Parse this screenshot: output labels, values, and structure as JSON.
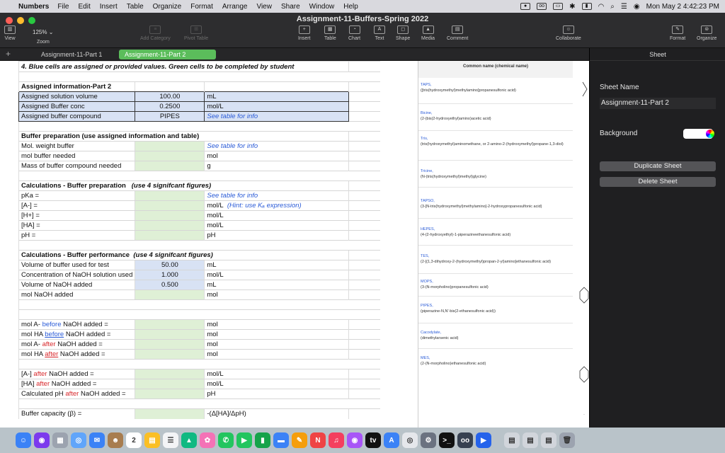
{
  "menubar": {
    "app": "Numbers",
    "items": [
      "File",
      "Edit",
      "Insert",
      "Table",
      "Organize",
      "Format",
      "Arrange",
      "View",
      "Share",
      "Window",
      "Help"
    ],
    "clock": "Mon May 2  4:42:23 PM"
  },
  "window": {
    "title": "Assignment-11-Buffers-Spring 2022",
    "zoom": "125%",
    "toolbar": {
      "view": "View",
      "zoom": "Zoom",
      "add_category": "Add Category",
      "pivot_table": "Pivot Table",
      "insert": "Insert",
      "table": "Table",
      "chart": "Chart",
      "text": "Text",
      "shape": "Shape",
      "media": "Media",
      "comment": "Comment",
      "collaborate": "Collaborate",
      "format": "Format",
      "organize": "Organize"
    }
  },
  "tabs": [
    "Assignment-11-Part 1",
    "Assignment-11-Part 2"
  ],
  "sheet": {
    "instruction": "4. Blue cells are assigned or provided values. Green cells to be completed by student",
    "assigned_header": "Assigned information-Part 2",
    "assigned": [
      {
        "label": "Assigned solution volume",
        "value": "100.00",
        "unit": "mL"
      },
      {
        "label": "Assigned Buffer conc",
        "value": "0.2500",
        "unit": "mol/L"
      },
      {
        "label": "Assigned buffer compound",
        "value": "PIPES",
        "unit": "See table for info"
      }
    ],
    "prep_header": "Buffer preparation (use assigned information and table)",
    "prep": [
      {
        "label": "Mol. weight buffer",
        "unit": "See table for info"
      },
      {
        "label": "mol buffer needed",
        "unit": "mol"
      },
      {
        "label": "Mass of buffer compound needed",
        "unit": "g"
      }
    ],
    "calc_prep_header": "Calculations - Buffer preparation",
    "calc_prep_note": "(use 4 signifcant figures)",
    "calc_prep": [
      {
        "label": "pKa =",
        "unit": "See table for info"
      },
      {
        "label": "[A-] =",
        "unit": "mol/L",
        "hint": "(Hint:  use Kₐ expression)"
      },
      {
        "label": "[H+] =",
        "unit": "mol/L"
      },
      {
        "label": "[HA] =",
        "unit": "mol/L"
      },
      {
        "label": "pH =",
        "unit": "pH"
      }
    ],
    "calc_perf_header": "Calculations - Buffer performance",
    "calc_perf_note": "(use 4 signifcant figures)",
    "calc_perf": [
      {
        "label": "Volume of buffer used for test",
        "value": "50.00",
        "unit": "mL"
      },
      {
        "label": "Concentration of NaOH solution used",
        "value": "1.000",
        "unit": "mol/L"
      },
      {
        "label": "Volume of NaOH added",
        "value": "0.500",
        "unit": "mL"
      },
      {
        "label": "mol NaOH added",
        "value": "",
        "unit": "mol"
      }
    ],
    "mol_rows": [
      {
        "pre": "mol A- ",
        "key": "before",
        "post": " NaOH added =",
        "unit": "mol"
      },
      {
        "pre": "mol HA ",
        "key": "before",
        "post": " NaOH added =",
        "unit": "mol"
      },
      {
        "pre": "mol A- ",
        "key": "after",
        "post": " NaOH added =",
        "unit": "mol"
      },
      {
        "pre": "mol HA ",
        "key": "after",
        "post": " NaOH added =",
        "unit": "mol"
      }
    ],
    "conc_rows": [
      {
        "pre": "[A-] ",
        "key": "after",
        "post": " NaOH added =",
        "unit": "mol/L"
      },
      {
        "pre": "[HA] ",
        "key": "after",
        "post": " NaOH added  =",
        "unit": "mol/L"
      },
      {
        "pre": "Calculated pH ",
        "key": "after",
        "post": " NaOH added =",
        "unit": "pH"
      }
    ],
    "capacity": {
      "label": "Buffer capacity (β)  =",
      "unit": "-(Δ[HA]/ΔpH)"
    }
  },
  "buffer_table": {
    "header": "Common name (chemical name)",
    "rows": [
      {
        "name": "TAPS,",
        "chem": "([tris(hydroxymethyl)methylamino]propanesulfonic acid)"
      },
      {
        "name": "Bicine,",
        "chem": "(2-(bis(2-hydroxyethyl)amino)acetic acid)"
      },
      {
        "name": "Tris,",
        "chem": "(tris(hydroxymethyl)aminomethane, or 2-amino-2-(hydroxymethyl)propane-1,3-diol)"
      },
      {
        "name": "Tricine,",
        "chem": "(N-(tris(hydroxymethyl)methyl)glycine)"
      },
      {
        "name": "TAPSO,",
        "chem": "(3-[N-tris(hydroxymethyl)methylamino]-2-hydroxypropanesulfonic acid)"
      },
      {
        "name": "HEPES,",
        "chem": "(4-(2-hydroxyethyl)-1-piperazineethanesulfonic acid)"
      },
      {
        "name": "TES,",
        "chem": "(2-[(1,3-dihydroxy-2-(hydroxymethyl)propan-2-yl)amino]ethanesulfonic acid)"
      },
      {
        "name": "MOPS,",
        "chem": "(3-(N-morpholino)propanesulfonic acid)"
      },
      {
        "name": "PIPES,",
        "chem": "(piperazine-N,N'-bis(2-ethanesulfonic acid))"
      },
      {
        "name": "Cacodylate,",
        "chem": "(dimethylarsenic acid)"
      },
      {
        "name": "MES,",
        "chem": "(2-(N-morpholino)ethanesulfonic acid)"
      }
    ]
  },
  "inspector": {
    "tab": "Sheet",
    "sheet_name_label": "Sheet Name",
    "sheet_name": "Assignment-11-Part 2",
    "background_label": "Background",
    "duplicate": "Duplicate Sheet",
    "delete": "Delete Sheet"
  }
}
